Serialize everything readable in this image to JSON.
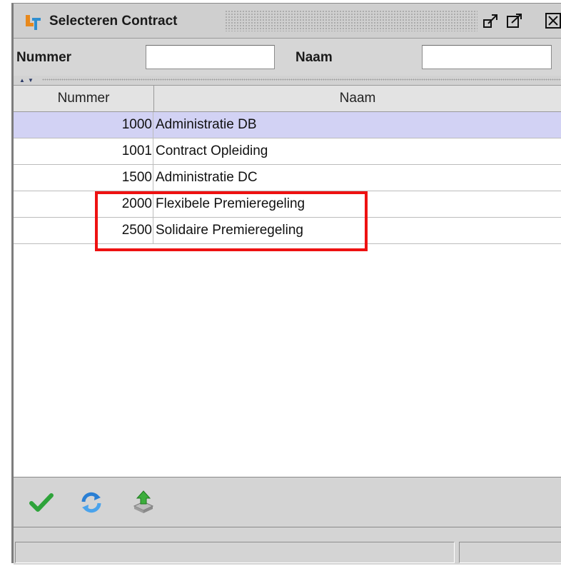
{
  "window": {
    "title": "Selecteren Contract",
    "icon": "app-logo-icon",
    "controls": [
      "restore-icon",
      "maximize-icon",
      "close-icon"
    ]
  },
  "filter": {
    "nummer_label": "Nummer",
    "nummer_value": "",
    "naam_label": "Naam",
    "naam_value": ""
  },
  "table": {
    "columns": [
      "Nummer",
      "Naam"
    ],
    "rows": [
      {
        "nummer": "1000",
        "naam": "Administratie DB",
        "selected": true
      },
      {
        "nummer": "1001",
        "naam": "Contract Opleiding",
        "selected": false
      },
      {
        "nummer": "1500",
        "naam": "Administratie DC",
        "selected": false
      },
      {
        "nummer": "2000",
        "naam": "Flexibele Premieregeling",
        "selected": false
      },
      {
        "nummer": "2500",
        "naam": "Solidaire Premieregeling",
        "selected": false
      }
    ]
  },
  "toolbar": {
    "buttons": [
      "confirm-check-icon",
      "refresh-icon",
      "export-icon"
    ]
  },
  "status": {
    "left": "",
    "right": ""
  },
  "colors": {
    "selected_row": "#d2d2f4",
    "highlight_box": "#ee1111",
    "frame": "#d4d4d4"
  }
}
